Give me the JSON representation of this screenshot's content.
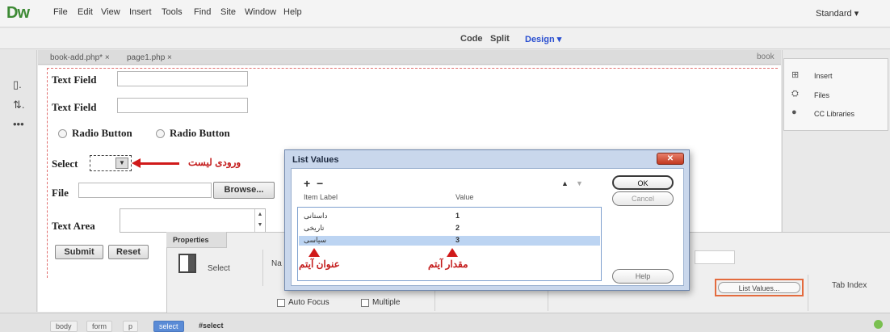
{
  "app": {
    "logo": "Dw",
    "menu": [
      "File",
      "Edit",
      "View",
      "Insert",
      "Tools",
      "Find",
      "Site",
      "Window",
      "Help"
    ],
    "workspace": "Standard ▾"
  },
  "viewbar": {
    "code": "Code",
    "split": "Split",
    "design": "Design ▾"
  },
  "tabs": [
    {
      "label": "book-add.php* ×"
    },
    {
      "label": "page1.php ×"
    }
  ],
  "tab_overflow": "book",
  "form": {
    "text_field_1": "Text Field",
    "text_field_2": "Text Field",
    "radio_1": "Radio Button",
    "radio_2": "Radio Button",
    "select_label": "Select",
    "file_label": "File",
    "browse_button": "Browse...",
    "textarea_label": "Text Area",
    "submit_button": "Submit",
    "reset_button": "Reset"
  },
  "annotations": {
    "select_arrow_label": "ورودی لیست",
    "item_label_caption": "عنوان آیتم",
    "value_caption": "مقدار آیتم"
  },
  "right_panel": {
    "items": [
      "Insert",
      "Files",
      "CC Libraries"
    ]
  },
  "properties": {
    "tab": "Properties",
    "type_label": "Select",
    "name_abbrev": "Na",
    "list_values_button": "List Values...",
    "tab_index": "Tab Index",
    "auto_focus": "Auto Focus",
    "multiple": "Multiple"
  },
  "dialog": {
    "title": "List Values",
    "close": "✕",
    "plus": "+",
    "minus": "−",
    "up": "▲",
    "down": "▼",
    "header_label": "Item Label",
    "header_value": "Value",
    "rows": [
      {
        "label": "داستانی",
        "value": "1"
      },
      {
        "label": "تاریخی",
        "value": "2"
      },
      {
        "label": "سیاسی",
        "value": "3"
      }
    ],
    "ok": "OK",
    "cancel": "Cancel",
    "help": "Help"
  },
  "statusbar": {
    "crumbs": [
      "body",
      "form",
      "p",
      "select",
      "#select"
    ]
  }
}
